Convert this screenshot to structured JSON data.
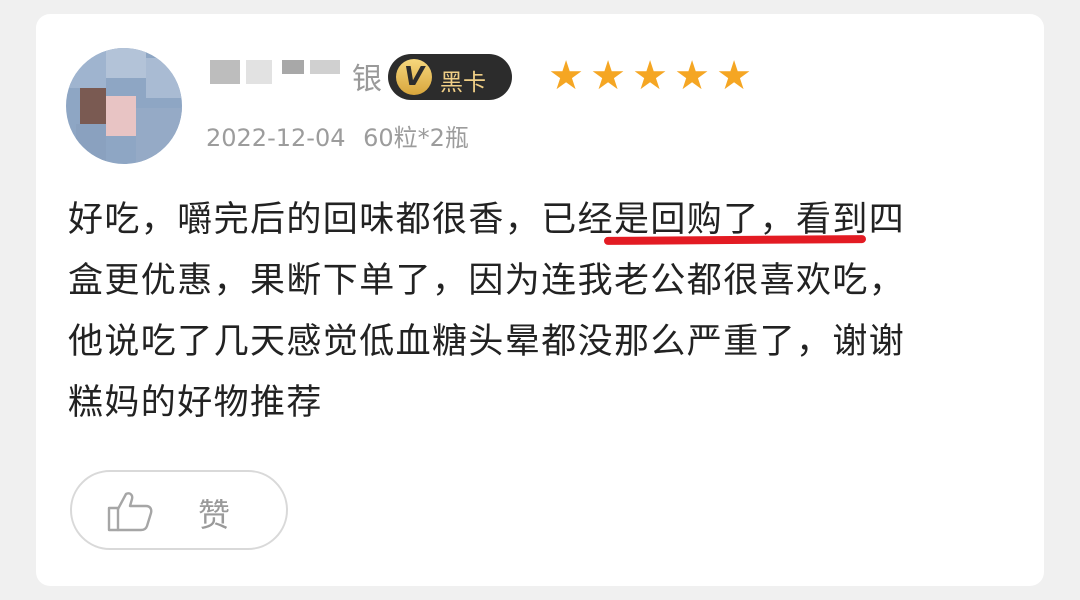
{
  "review": {
    "user": {
      "name_visible_tail": "银",
      "badge": {
        "label": "黑卡",
        "icon": "v-vip-icon"
      }
    },
    "rating": {
      "stars": 5,
      "max": 5
    },
    "date": "2022-12-04",
    "spec": "60粒*2瓶",
    "text_lines": [
      "好吃，嚼完后的回味都很香，已经是回购了，看到四",
      "盒更优惠，果断下单了，因为连我老公都很喜欢吃，",
      "他说吃了几天感觉低血糖头晕都没那么严重了，谢谢",
      "糕妈的好物推荐"
    ],
    "highlight": "已经是回购了"
  },
  "actions": {
    "like_label": "赞",
    "like_icon": "thumbs-up-icon"
  },
  "colors": {
    "star": "#f5a623",
    "badge_bg": "#2c2c2c",
    "badge_text": "#f0cf86",
    "underline": "#e31b23",
    "meta_text": "#9c9c9c"
  }
}
